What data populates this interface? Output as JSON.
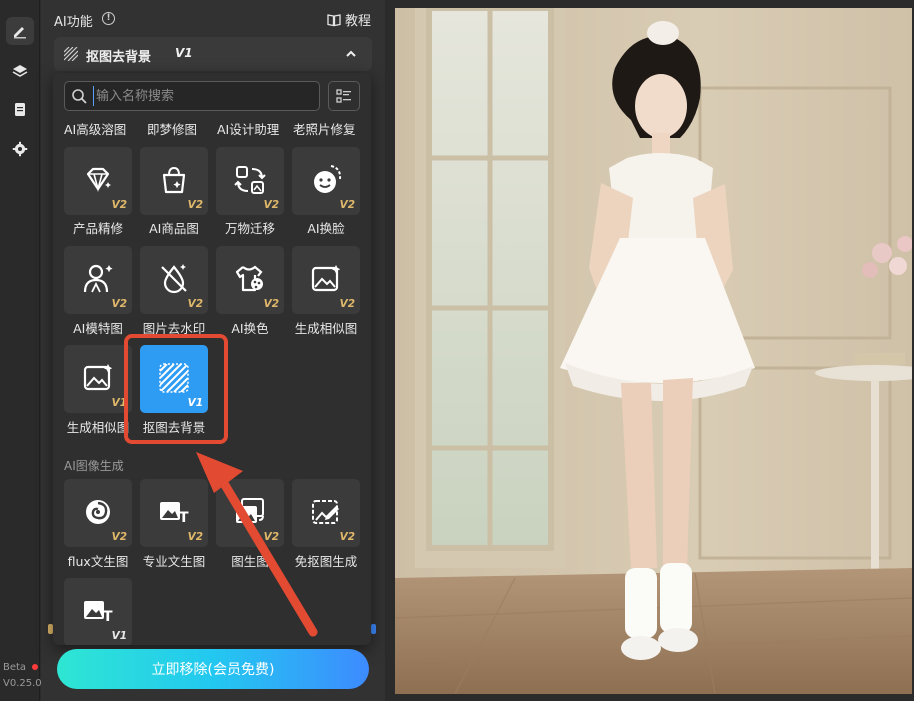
{
  "rail": {
    "beta": "Beta",
    "version": "V0.25.0"
  },
  "panel": {
    "title": "AI功能",
    "tutorial": "教程",
    "feature_name": "抠图去背景",
    "feature_version": "V1"
  },
  "search": {
    "placeholder": "输入名称搜索"
  },
  "top_row": [
    "AI高级溶图",
    "即梦修图",
    "AI设计助理",
    "老照片修复"
  ],
  "tools": [
    {
      "label": "产品精修",
      "version": "V2",
      "icon": "diamond-sparkle-icon"
    },
    {
      "label": "AI商品图",
      "version": "V2",
      "icon": "shopping-bag-icon"
    },
    {
      "label": "万物迁移",
      "version": "V2",
      "icon": "transfer-icon"
    },
    {
      "label": "AI换脸",
      "version": "V2",
      "icon": "face-swap-icon"
    },
    {
      "label": "AI模特图",
      "version": "V2",
      "icon": "model-person-icon"
    },
    {
      "label": "图片去水印",
      "version": "V2",
      "icon": "remove-watermark-icon"
    },
    {
      "label": "AI换色",
      "version": "V2",
      "icon": "tshirt-palette-icon"
    },
    {
      "label": "生成相似图",
      "version": "V2",
      "icon": "image-sparkle-icon"
    },
    {
      "label": "生成相似图",
      "version": "V1",
      "icon": "image-sparkle-icon"
    },
    {
      "label": "抠图去背景",
      "version": "V1",
      "icon": "hatch-icon"
    }
  ],
  "section_gen": "AI图像生成",
  "gen_tools": [
    {
      "label": "flux文生图",
      "version": "V2",
      "icon": "swirl-icon"
    },
    {
      "label": "专业文生图",
      "version": "V2",
      "icon": "image-text-icon"
    },
    {
      "label": "图生图",
      "version": "V2",
      "icon": "image-to-image-icon"
    },
    {
      "label": "免抠图生成",
      "version": "V2",
      "icon": "image-edit-icon"
    },
    {
      "label": "",
      "version": "V1",
      "icon": "image-text-icon"
    }
  ],
  "cta": "立即移除(会员免费)",
  "colors": {
    "accent": "#2f9cf3",
    "highlight": "#e34a32",
    "version_badge": "#e0b86a"
  }
}
